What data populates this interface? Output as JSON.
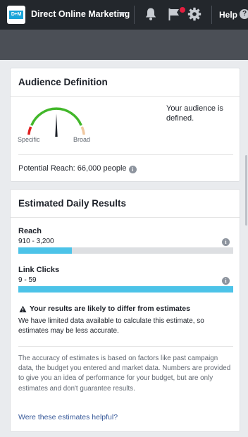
{
  "topbar": {
    "logo_text": "D+M",
    "account_name": "Direct Online Marketing",
    "help_label": "Help",
    "help_icon_glyph": "?",
    "icons": [
      "bell-icon",
      "flag-icon",
      "gear-icon",
      "help-icon"
    ],
    "notification_color": "#e41e3f"
  },
  "audience_definition": {
    "title": "Audience Definition",
    "gauge": {
      "left_label": "Specific",
      "right_label": "Broad",
      "needle_level": 0.5
    },
    "status_text": "Your audience is defined.",
    "potential_reach": "Potential Reach: 66,000 people"
  },
  "estimated_results": {
    "title": "Estimated Daily Results",
    "metrics": [
      {
        "label": "Reach",
        "range": "910 - 3,200",
        "fill_fraction": 0.25
      },
      {
        "label": "Link Clicks",
        "range": "9 - 59",
        "fill_fraction": 1.0
      }
    ],
    "warning_title": "Your results are likely to differ from estimates",
    "warning_body": "We have limited data available to calculate this estimate, so estimates may be less accurate.",
    "disclaimer": "The accuracy of estimates is based on factors like past campaign data, the budget you entered and market data. Numbers are provided to give you an idea of performance for your budget, but are only estimates and don't guarantee results.",
    "helpful_link": "Were these estimates helpful?"
  },
  "colors": {
    "topbar_bg": "#23272c",
    "bar_fill": "#4cc3e8",
    "link": "#365899",
    "gauge_green": "#42b72a",
    "gauge_red": "#e02020",
    "gauge_tan": "#f0c8a0"
  },
  "info_glyph": "i"
}
